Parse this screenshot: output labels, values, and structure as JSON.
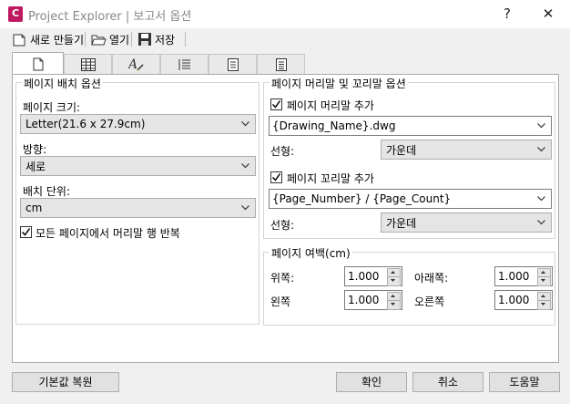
{
  "titlebar": {
    "app_icon_letter": "C",
    "title": "Project Explorer | 보고서 옵션",
    "help": "?",
    "close": "✕"
  },
  "toolbar": {
    "new_label": "새로 만들기",
    "open_label": "열기",
    "save_label": "저장"
  },
  "tabs": [
    "page",
    "table",
    "text-format",
    "list",
    "spreadsheet",
    "document"
  ],
  "page_layout": {
    "legend": "페이지 배치 옵션",
    "size_label": "페이지 크기:",
    "size_value": "Letter(21.6 x 27.9cm)",
    "orientation_label": "방향:",
    "orientation_value": "세로",
    "unit_label": "배치 단위:",
    "unit_value": "cm",
    "repeat_header_label": "모든 페이지에서 머리말 행 반복",
    "repeat_header_checked": true
  },
  "header_footer": {
    "legend": "페이지 머리말 및 꼬리말 옵션",
    "add_header_label": "페이지 머리말 추가",
    "add_header_checked": true,
    "header_value": "{Drawing_Name}.dwg",
    "header_align_label": "선형:",
    "header_align_value": "가운데",
    "add_footer_label": "페이지 꼬리말 추가",
    "add_footer_checked": true,
    "footer_value": "{Page_Number} / {Page_Count}",
    "footer_align_label": "선형:",
    "footer_align_value": "가운데"
  },
  "margins": {
    "legend": "페이지 여백(cm)",
    "top_label": "위쪽:",
    "top_value": "1.000",
    "bottom_label": "아래쪽:",
    "bottom_value": "1.000",
    "left_label": "왼쪽",
    "left_value": "1.000",
    "right_label": "오른쪽",
    "right_value": "1.000"
  },
  "buttons": {
    "restore_defaults": "기본값 복원",
    "ok": "확인",
    "cancel": "취소",
    "help": "도움말"
  }
}
